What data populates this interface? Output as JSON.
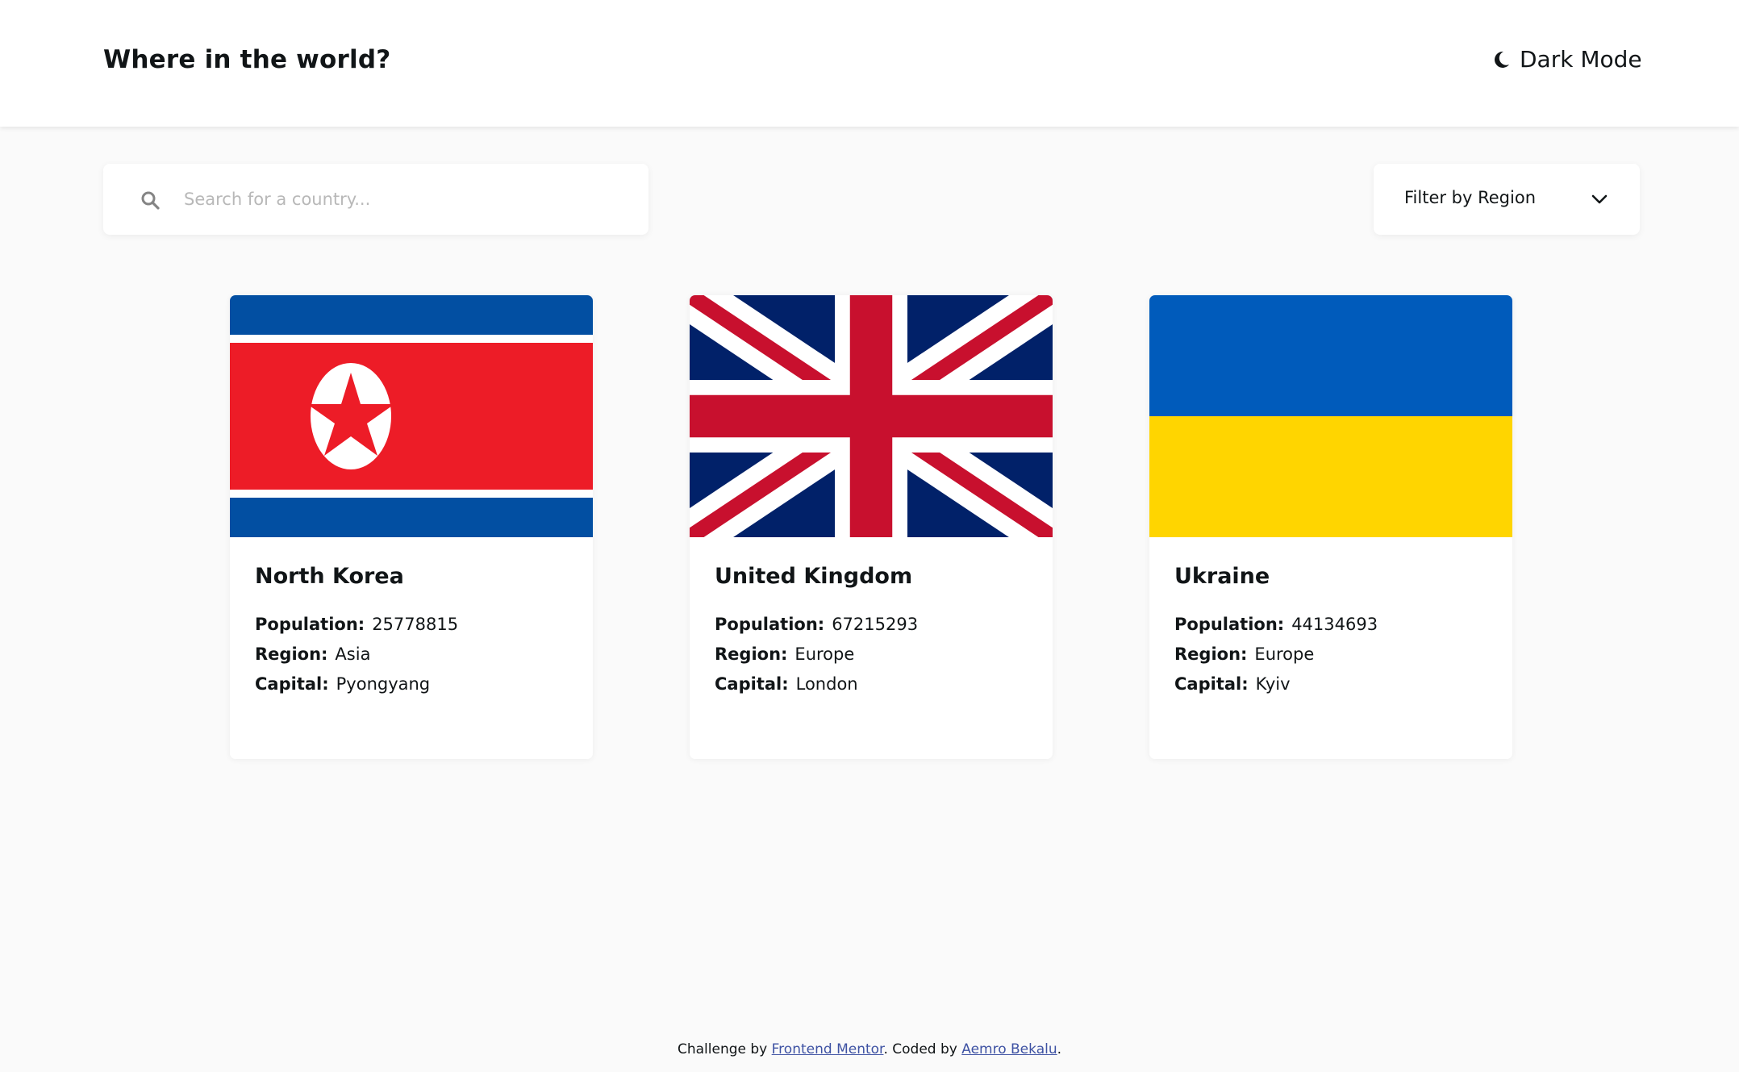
{
  "header": {
    "title": "Where in the world?",
    "dark_mode_label": "Dark Mode",
    "dark_mode_icon": "moon-icon"
  },
  "search": {
    "placeholder": "Search for a country...",
    "value": "",
    "icon": "search-icon"
  },
  "filter": {
    "label": "Filter by Region",
    "icon": "chevron-down-icon"
  },
  "labels": {
    "population": "Population:",
    "region": "Region:",
    "capital": "Capital:"
  },
  "countries": [
    {
      "name": "North Korea",
      "population": "25778815",
      "region": "Asia",
      "capital": "Pyongyang",
      "flag": "north-korea-flag"
    },
    {
      "name": "United Kingdom",
      "population": "67215293",
      "region": "Europe",
      "capital": "London",
      "flag": "united-kingdom-flag"
    },
    {
      "name": "Ukraine",
      "population": "44134693",
      "region": "Europe",
      "capital": "Kyiv",
      "flag": "ukraine-flag"
    }
  ],
  "footer": {
    "prefix": "Challenge by ",
    "link1": "Frontend Mentor",
    "middle": ". Coded by ",
    "link2": "Aemro Bekalu",
    "suffix": "."
  },
  "colors": {
    "background": "#fafafa",
    "element": "#ffffff",
    "text": "#111517",
    "input_placeholder": "#b8b8b8",
    "link": "#3e52a3"
  }
}
